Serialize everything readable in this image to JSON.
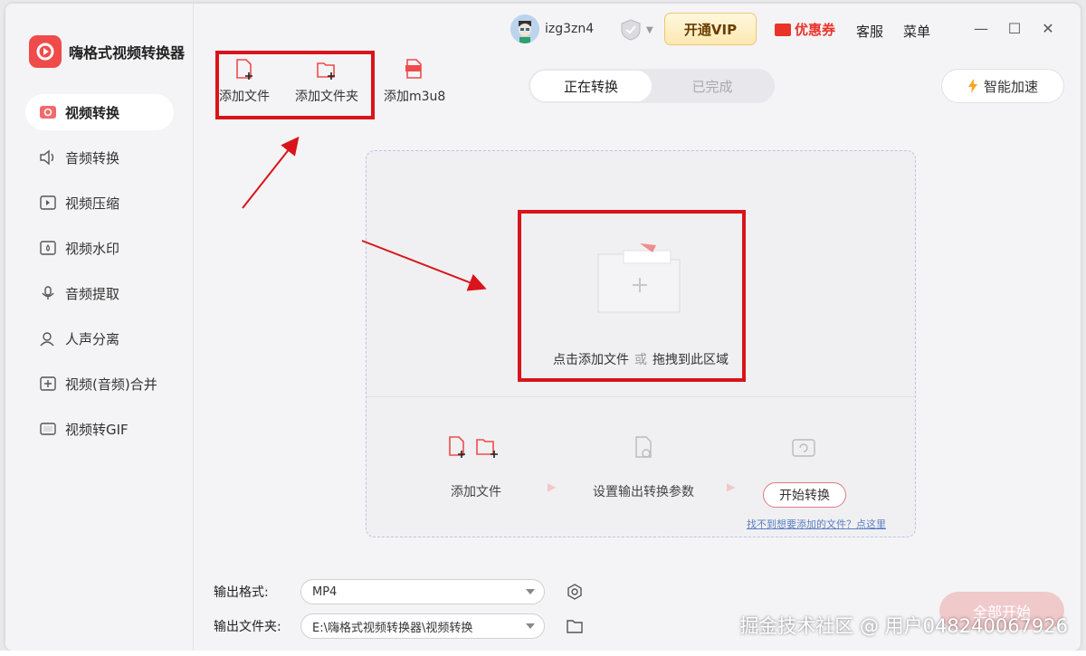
{
  "app": {
    "name": "嗨格式视频转换器"
  },
  "sidebar": {
    "items": [
      {
        "label": "视频转换",
        "icon": "video-convert-icon",
        "active": true
      },
      {
        "label": "音频转换",
        "icon": "audio-convert-icon"
      },
      {
        "label": "视频压缩",
        "icon": "video-compress-icon"
      },
      {
        "label": "视频水印",
        "icon": "watermark-icon"
      },
      {
        "label": "音频提取",
        "icon": "audio-extract-icon"
      },
      {
        "label": "人声分离",
        "icon": "voice-separate-icon"
      },
      {
        "label": "视频(音频)合并",
        "icon": "merge-icon"
      },
      {
        "label": "视频转GIF",
        "icon": "gif-icon"
      }
    ]
  },
  "titlebar": {
    "username": "izg3zn4",
    "vip_label": "开通VIP",
    "coupon_label": "优惠券",
    "service_label": "客服",
    "menu_label": "菜单"
  },
  "toolbar": {
    "add_file": "添加文件",
    "add_folder": "添加文件夹",
    "add_m3u8": "添加m3u8"
  },
  "tabs": {
    "converting": "正在转换",
    "completed": "已完成",
    "active": "converting"
  },
  "speed_label": "智能加速",
  "dropzone": {
    "text_main": "点击添加文件",
    "text_or": "或",
    "text_drag": "拖拽到此区域",
    "steps": {
      "add": "添加文件",
      "settings": "设置输出转换参数",
      "start": "开始转换"
    },
    "help_link": "找不到想要添加的文件？点这里"
  },
  "output": {
    "format_label": "输出格式:",
    "format_value": "MP4",
    "folder_label": "输出文件夹:",
    "folder_value": "E:\\嗨格式视频转换器\\视频转换"
  },
  "all_start_label": "全部开始",
  "watermark_text": "掘金技术社区 @ 用户048240067926",
  "colors": {
    "accent": "#ef4b4b",
    "annotation": "#d9141a",
    "vip": "#fde8b2"
  }
}
